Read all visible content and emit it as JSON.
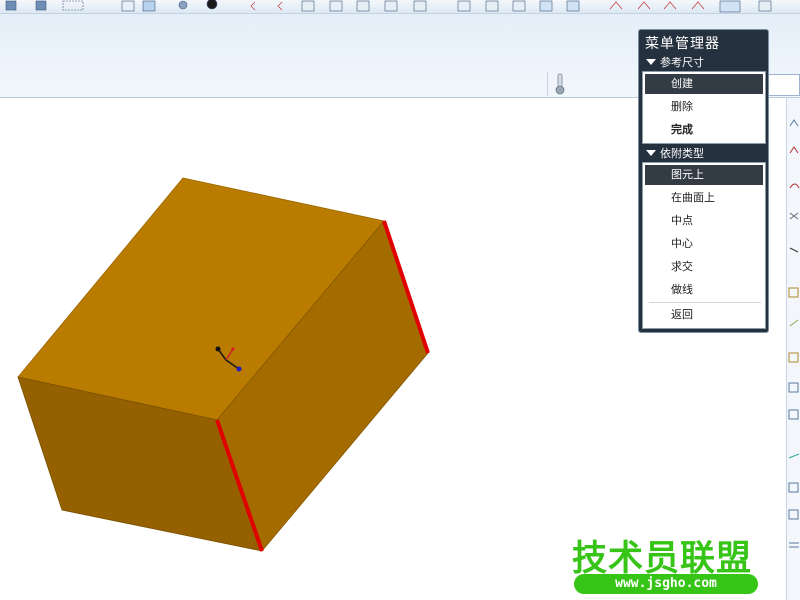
{
  "menu_manager": {
    "title": "菜单管理器",
    "sections": [
      {
        "title": "参考尺寸",
        "items": [
          {
            "label": "创建",
            "selected": true,
            "bold": false
          },
          {
            "label": "删除",
            "selected": false,
            "bold": false
          },
          {
            "label": "完成",
            "selected": false,
            "bold": true
          }
        ]
      },
      {
        "title": "依附类型",
        "items": [
          {
            "label": "图元上",
            "selected": true,
            "bold": false
          },
          {
            "label": "在曲面上",
            "selected": false,
            "bold": false
          },
          {
            "label": "中点",
            "selected": false,
            "bold": false
          },
          {
            "label": "中心",
            "selected": false,
            "bold": false
          },
          {
            "label": "求交",
            "selected": false,
            "bold": false
          },
          {
            "label": "做线",
            "selected": false,
            "bold": false
          },
          {
            "label": "返回",
            "selected": false,
            "bold": false
          }
        ]
      }
    ]
  },
  "watermark": {
    "text": "技术员联盟",
    "url": "www.jsgho.com"
  },
  "colors": {
    "box_top": "#b97b00",
    "box_left": "#946000",
    "box_right": "#a36b00",
    "highlight_edge": "#e00000",
    "menu_bg": "#25313e",
    "watermark_green": "#36c417"
  }
}
